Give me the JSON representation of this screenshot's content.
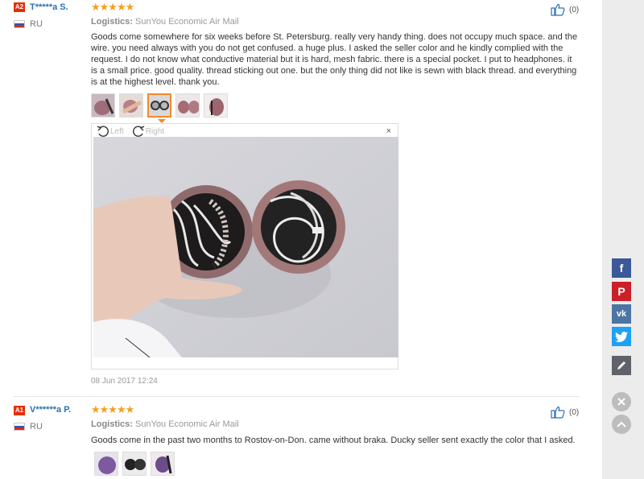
{
  "reviews": [
    {
      "badge": "A2",
      "username": "T*****a S.",
      "country": "RU",
      "stars": "★★★★★",
      "logistics_label": "Logistics:",
      "logistics_value": "SunYou Economic Air Mail",
      "text": "Goods come somewhere for six weeks before St. Petersburg. really very handy thing. does not occupy much space. and the wire. you need always with you do not get confused. a huge plus. I asked the seller color and he kindly complied with the request. I do not know what conductive material but it is hard, mesh fabric. there is a special pocket. I put to headphones. it is a small price. good quality. thread sticking out one. but the only thing did not like is sewn with black thread. and everything is at the highest level. thank you.",
      "likes": "(0)",
      "date": "08 Jun 2017 12:24",
      "viewer": {
        "left_label": "Left",
        "right_label": "Right",
        "close": "×"
      }
    },
    {
      "badge": "A1",
      "username": "V******a P.",
      "country": "RU",
      "stars": "★★★★★",
      "logistics_label": "Logistics:",
      "logistics_value": "SunYou Economic Air Mail",
      "text": "Goods come in the past two months to Rostov-on-Don. came without braka. Ducky seller sent exactly the color that I asked.",
      "likes": "(0)"
    }
  ],
  "share": {
    "facebook": "f",
    "pinterest": "P",
    "vk": "vk",
    "twitter": "twitter-icon"
  },
  "colors": {
    "accent": "#e62e04",
    "star": "#f4a01d",
    "link": "#2b6fb6",
    "facebook": "#3b5998",
    "pinterest": "#cb2027",
    "vk": "#4c75a3",
    "twitter": "#1da1f2"
  }
}
